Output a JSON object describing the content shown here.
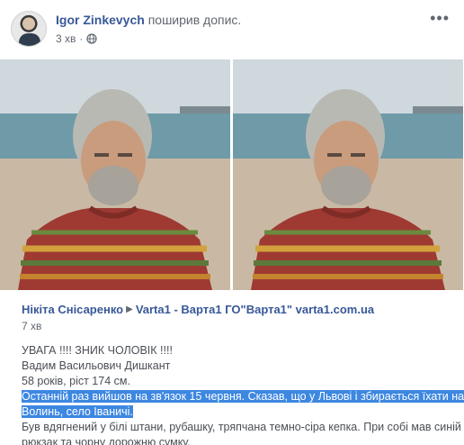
{
  "post": {
    "author": "Igor Zinkevych",
    "action": "поширив допис.",
    "time": "3 хв",
    "more_icon": "more-dots-icon",
    "privacy_icon": "globe-icon"
  },
  "shared": {
    "author": "Нікіта Снісаренко",
    "separator_icon": "triangle-right-icon",
    "page": "Varta1 - Варта1 ГО\"Варта1\" varta1.com.ua",
    "time": "7 хв",
    "lines": {
      "l1": "УВАГА !!!! ЗНИК ЧОЛОВІК !!!!",
      "l2": "Вадим Васильович Дишкант",
      "l3": "58 років, ріст 174 см.",
      "l4": "Останній раз вийшов на зв'язок 15 червня. Сказав, що у Львові і збирається їхати на",
      "l5": "Волинь, село Іваничі.",
      "l6": "Був вдягнений у білі штани, рубашку, тряпчана темно-сіра кепка. При собі мав синій",
      "l7": "рюкзак та чорну дорожню сумку."
    }
  },
  "colors": {
    "link": "#385898",
    "highlight": "#3d87e0"
  }
}
